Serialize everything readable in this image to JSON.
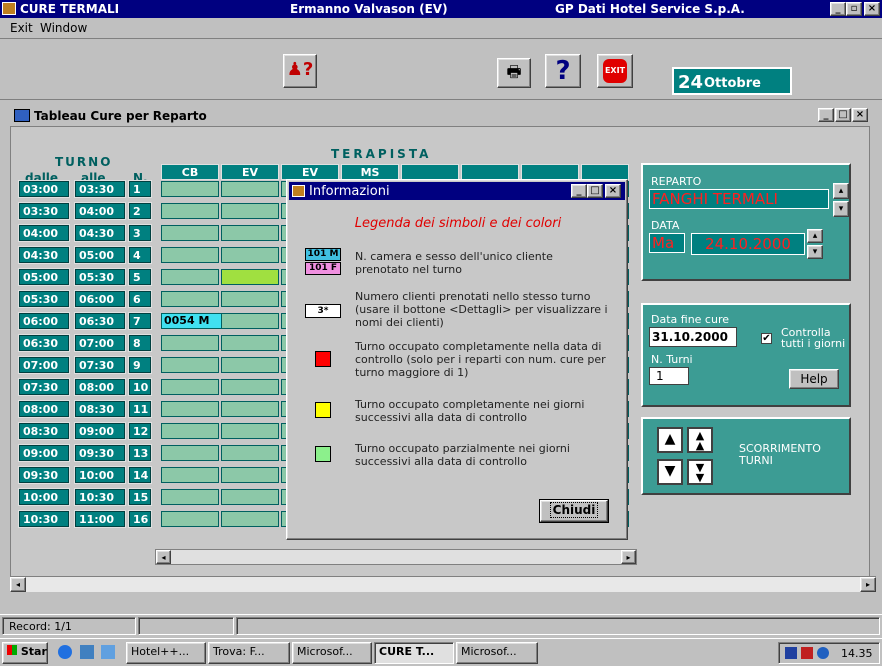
{
  "app": {
    "title": "CURE TERMALI",
    "user": "Ermanno Valvason (EV)",
    "company": "GP Dati Hotel Service S.p.A."
  },
  "menu": {
    "exit": "Exit",
    "window": "Window"
  },
  "toolbar": {
    "date_day": "24",
    "date_month": "Ottobre",
    "help_glyph": "?",
    "exit_label": "EXIT"
  },
  "child": {
    "title": "Tableau Cure per Reparto",
    "turno_header": "TURNO",
    "dalle": "dalle",
    "alle": "alle",
    "n": "N.",
    "terapista": "TERAPISTA",
    "therapists": [
      "CB",
      "EV",
      "EV",
      "MS"
    ],
    "rows": [
      {
        "dalle": "03:00",
        "alle": "03:30",
        "n": "1"
      },
      {
        "dalle": "03:30",
        "alle": "04:00",
        "n": "2"
      },
      {
        "dalle": "04:00",
        "alle": "04:30",
        "n": "3"
      },
      {
        "dalle": "04:30",
        "alle": "05:00",
        "n": "4"
      },
      {
        "dalle": "05:00",
        "alle": "05:30",
        "n": "5"
      },
      {
        "dalle": "05:30",
        "alle": "06:00",
        "n": "6"
      },
      {
        "dalle": "06:00",
        "alle": "06:30",
        "n": "7"
      },
      {
        "dalle": "06:30",
        "alle": "07:00",
        "n": "8"
      },
      {
        "dalle": "07:00",
        "alle": "07:30",
        "n": "9"
      },
      {
        "dalle": "07:30",
        "alle": "08:00",
        "n": "10"
      },
      {
        "dalle": "08:00",
        "alle": "08:30",
        "n": "11"
      },
      {
        "dalle": "08:30",
        "alle": "09:00",
        "n": "12"
      },
      {
        "dalle": "09:00",
        "alle": "09:30",
        "n": "13"
      },
      {
        "dalle": "09:30",
        "alle": "10:00",
        "n": "14"
      },
      {
        "dalle": "10:00",
        "alle": "10:30",
        "n": "15"
      },
      {
        "dalle": "10:30",
        "alle": "11:00",
        "n": "16"
      }
    ],
    "cell_booking": "0054 M"
  },
  "reparto": {
    "label": "REPARTO",
    "value": "FANGHI TERMALI",
    "data_label": "DATA",
    "day": "Ma",
    "date": "24.10.2000"
  },
  "fine": {
    "label": "Data fine cure",
    "value": "31.10.2000",
    "check_label": "Controlla tutti i giorni",
    "nturni_label": "N. Turni",
    "nturni": "1",
    "help": "Help"
  },
  "scroll": {
    "label": "SCORRIMENTO TURNI"
  },
  "dialog": {
    "title": "Informazioni",
    "heading": "Legenda dei simboli e dei colori",
    "items": [
      {
        "sample_m": "101 M",
        "sample_f": "101 F",
        "text": "N. camera e sesso dell'unico cliente prenotato nel turno"
      },
      {
        "sample": "3*",
        "text": "Numero clienti prenotati nello stesso turno (usare il bottone <Dettagli> per visualizzare i nomi dei clienti)"
      },
      {
        "color": "#ff0000",
        "text": "Turno occupato completamente nella data di controllo (solo per i reparti con num. cure per turno maggiore di 1)"
      },
      {
        "color": "#ffff00",
        "text": "Turno occupato completamente nei giorni successivi alla data di controllo"
      },
      {
        "color": "#8cf08c",
        "text": "Turno occupato parzialmente nei giorni successivi alla data di controllo"
      }
    ],
    "close": "Chiudi"
  },
  "status": {
    "record": "Record: 1/1"
  },
  "taskbar": {
    "start": "Start",
    "buttons": [
      "Hotel++...",
      "Trova: F...",
      "Microsof...",
      "CURE T...",
      "Microsof..."
    ],
    "clock": "14.35"
  }
}
